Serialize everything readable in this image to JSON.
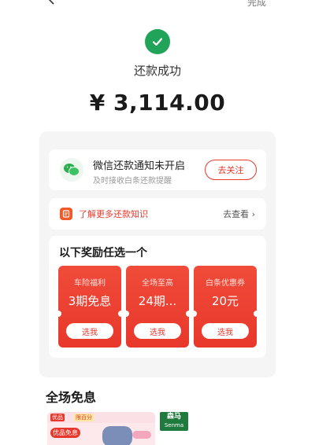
{
  "header": {
    "done_label": "完成"
  },
  "status": {
    "title": "还款成功",
    "amount": "¥ 3,114.00"
  },
  "wechat_notice": {
    "title": "微信还款通知未开启",
    "subtitle": "及时接收白条还款提醒",
    "button_label": "去关注"
  },
  "tips": {
    "text": "了解更多还款知识",
    "link_label": "去查看 ›"
  },
  "rewards": {
    "title": "以下奖励任选一个",
    "items": [
      {
        "label": "车险福利",
        "value": "3期免息",
        "button": "选我"
      },
      {
        "label": "全场至高",
        "value": "24期...",
        "button": "选我"
      },
      {
        "label": "白条优惠券",
        "value": "20元",
        "button": "选我"
      }
    ]
  },
  "section": {
    "title": "全场免息"
  },
  "promos": {
    "left": {
      "badge1": "优品",
      "badge2": "限百分",
      "tag": "优品免息"
    },
    "right": {
      "brand_cn": "森马",
      "brand_en": "Senma"
    }
  },
  "colors": {
    "accent": "#e6382c",
    "success": "#21a45a"
  }
}
